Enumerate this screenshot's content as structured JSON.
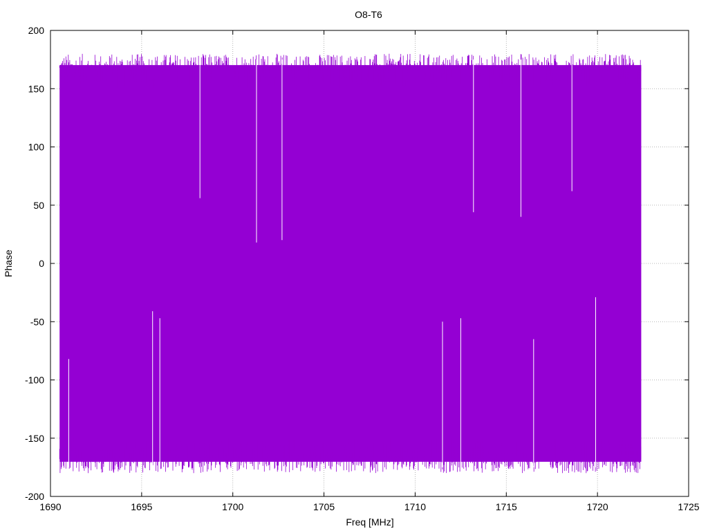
{
  "chart_data": {
    "type": "line",
    "title": "O8-T6",
    "xlabel": "Freq [MHz]",
    "ylabel": "Phase",
    "xlim": [
      1690,
      1725
    ],
    "ylim": [
      -200,
      200
    ],
    "x_ticks": [
      "1690",
      "1695",
      "1700",
      "1705",
      "1710",
      "1715",
      "1720",
      "1725"
    ],
    "y_ticks": [
      "200",
      "150",
      "100",
      "50",
      "0",
      "-50",
      "-100",
      "-150",
      "-200"
    ],
    "grid": true,
    "legend": "none",
    "series": [
      {
        "color": "#9400d3",
        "x_range": [
          1690.5,
          1722.4
        ],
        "y_envelope": [
          -180,
          180
        ],
        "description_values": {
          "typical_max": 175,
          "typical_min": -175
        },
        "notable_points": [
          {
            "x": 1701.3,
            "y_top": 18
          },
          {
            "x": 1702.7,
            "y_top": 20
          },
          {
            "x": 1698.2,
            "y_top": 56
          },
          {
            "x": 1713.2,
            "y_top": 44
          },
          {
            "x": 1715.8,
            "y_top": 40
          },
          {
            "x": 1718.6,
            "y_top": 62
          },
          {
            "x": 1695.6,
            "y_bottom": -41
          },
          {
            "x": 1696.0,
            "y_bottom": -47
          },
          {
            "x": 1711.5,
            "y_bottom": -50
          },
          {
            "x": 1712.5,
            "y_bottom": -47
          },
          {
            "x": 1719.9,
            "y_bottom": -29
          },
          {
            "x": 1716.5,
            "y_bottom": -65
          },
          {
            "x": 1691.0,
            "y_bottom": -82
          }
        ]
      }
    ]
  }
}
